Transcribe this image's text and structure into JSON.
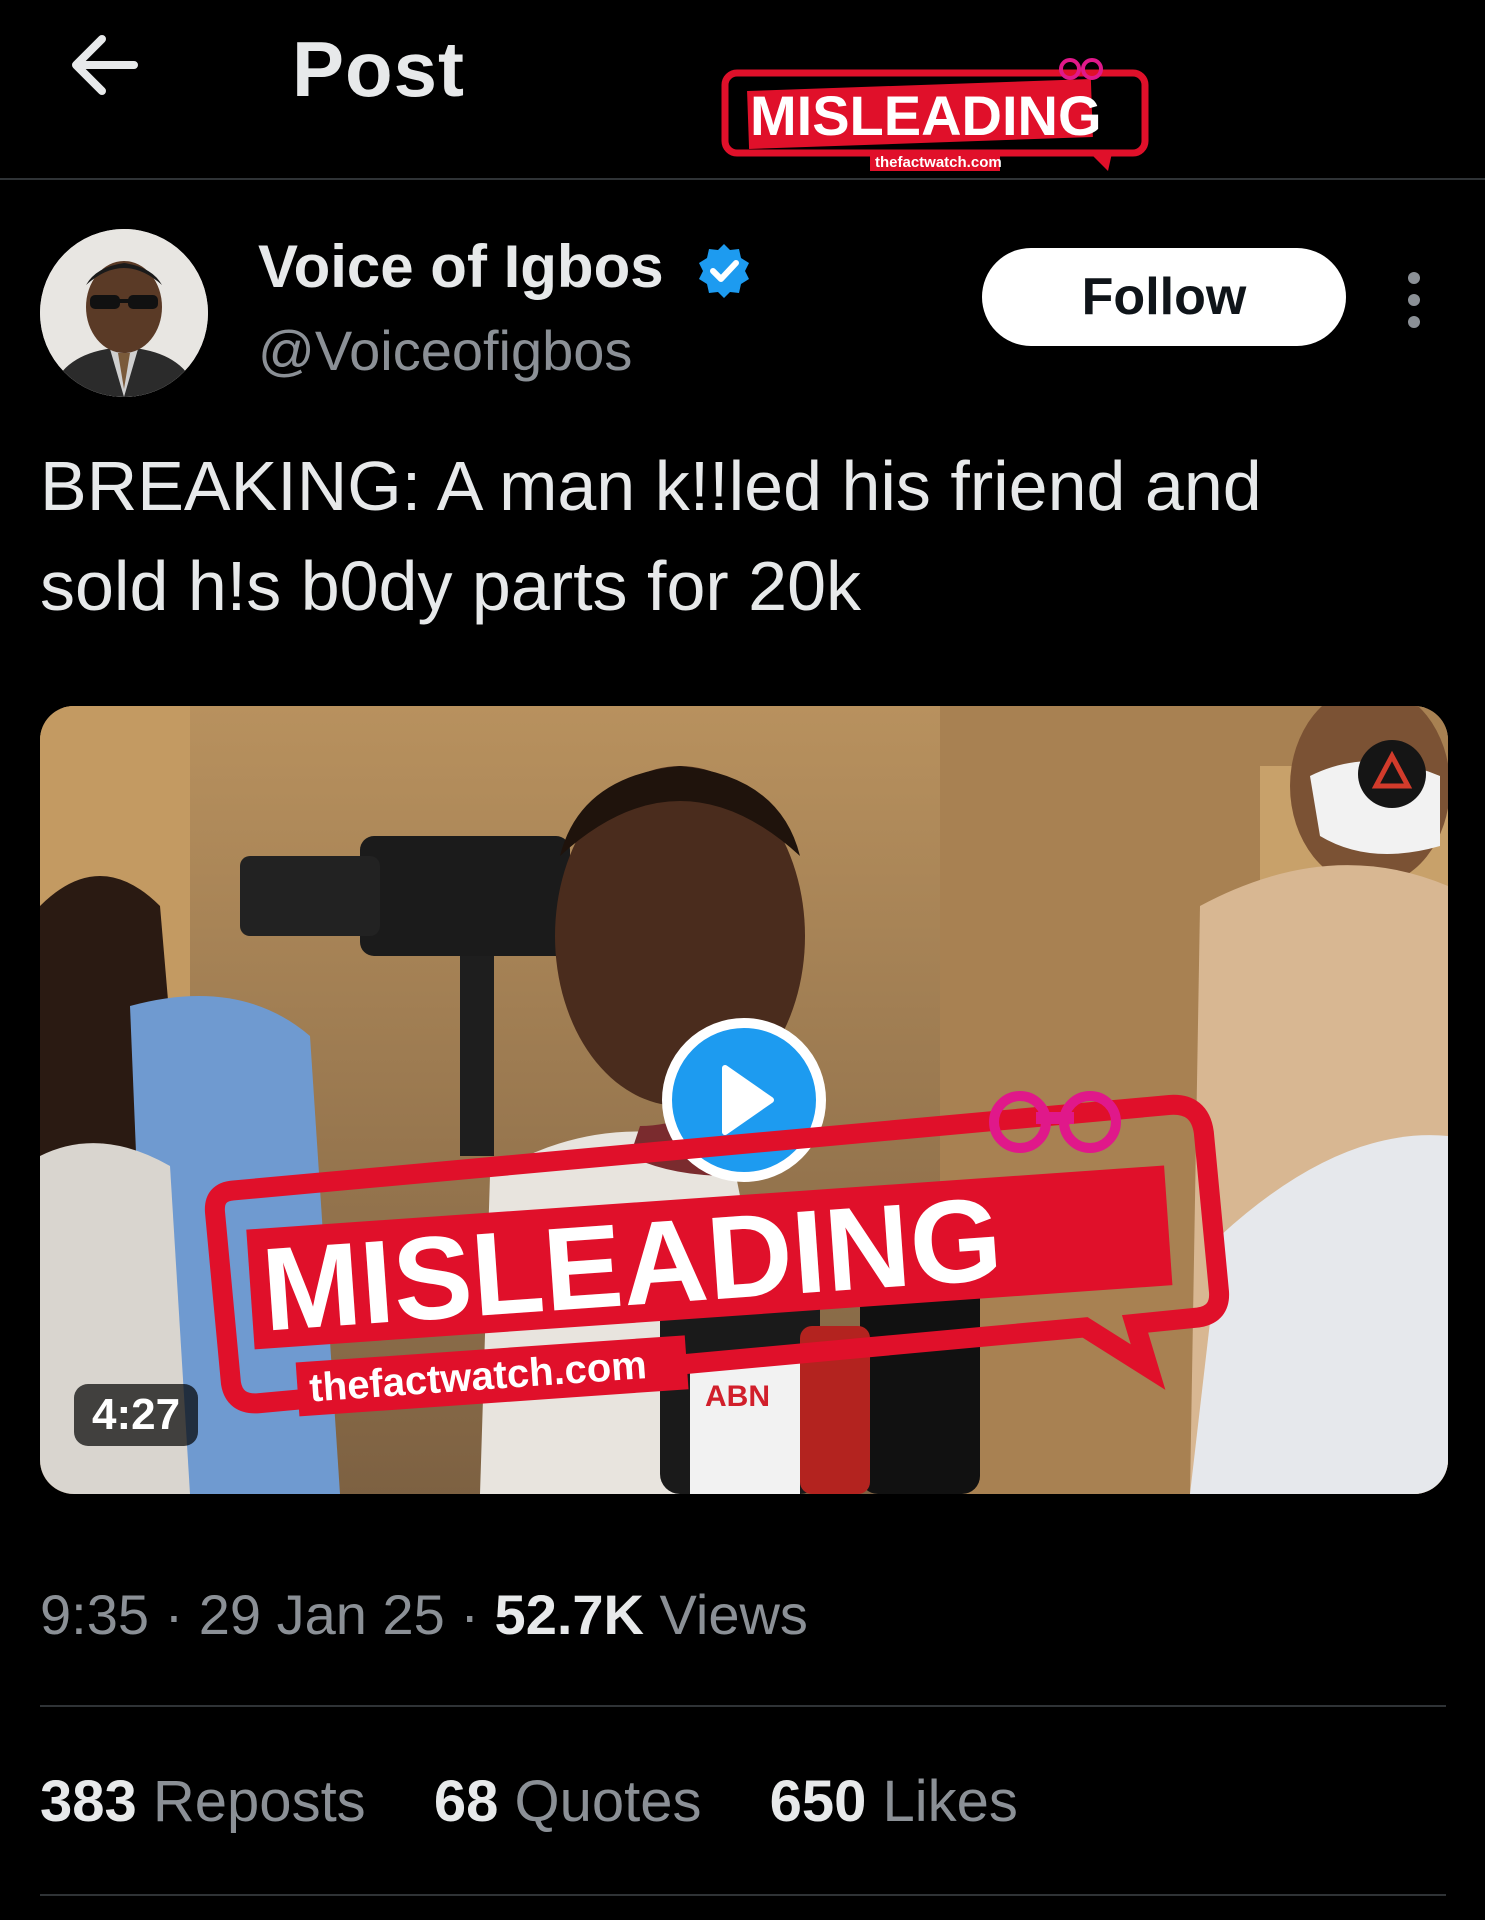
{
  "header": {
    "title": "Post",
    "back_icon": "arrow-left-icon"
  },
  "stamp": {
    "label": "MISLEADING",
    "site": "thefactwatch.com",
    "color": "#e0102a",
    "accent": "#e0188a"
  },
  "author": {
    "name": "Voice of Igbos",
    "handle": "@Voiceofigbos",
    "verified_color": "#1d9bf0",
    "follow_label": "Follow"
  },
  "post": {
    "text_line1": "BREAKING: A man k!!led his friend and",
    "text_line2": "sold h!s b0dy parts for 20k"
  },
  "media": {
    "duration": "4:27",
    "mic_logo": "ABN",
    "play_color": "#1d9bf0"
  },
  "meta": {
    "time": "9:35",
    "date": "29 Jan 25",
    "views_count": "52.7K",
    "views_label": "Views",
    "separator": "·"
  },
  "stats": {
    "reposts_count": "383",
    "reposts_label": "Reposts",
    "quotes_count": "68",
    "quotes_label": "Quotes",
    "likes_count": "650",
    "likes_label": "Likes"
  }
}
